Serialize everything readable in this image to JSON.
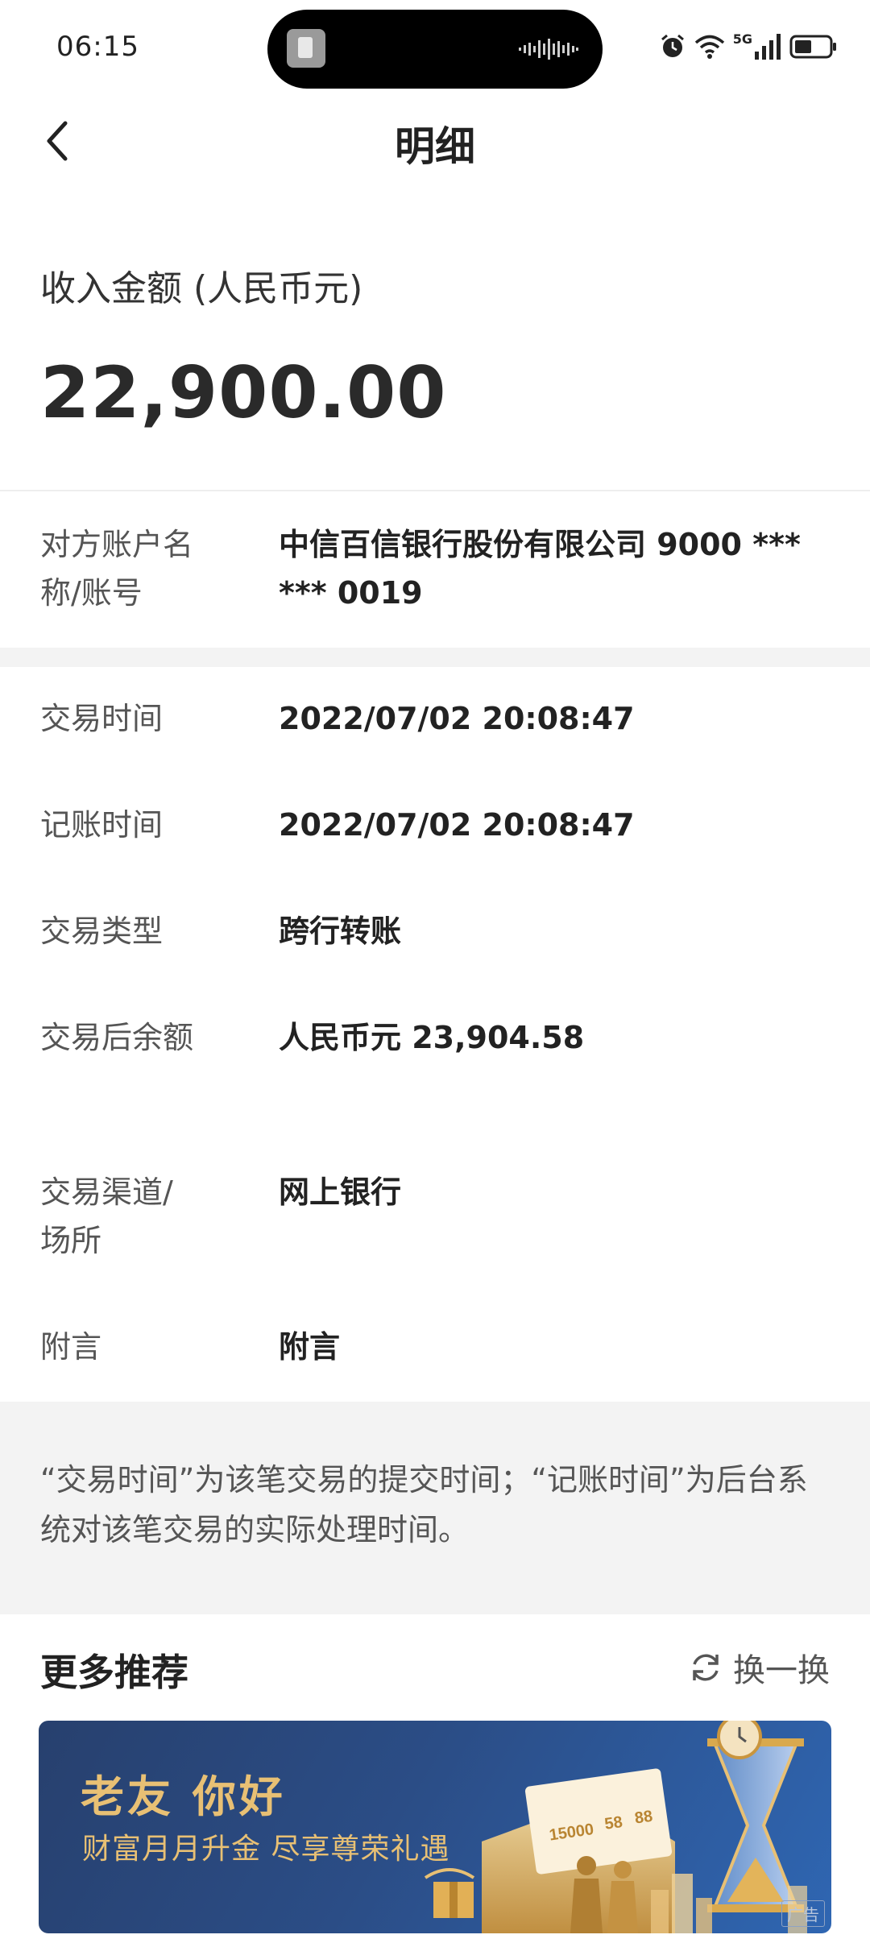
{
  "status_bar": {
    "time": "06:15",
    "network": "5G",
    "icons": [
      "alarm-icon",
      "wifi-icon",
      "signal-icon",
      "battery-icon"
    ]
  },
  "nav": {
    "title": "明细",
    "back_icon": "chevron-left-icon"
  },
  "amount": {
    "label": "收入金额 (人民币元)",
    "value": "22,900.00"
  },
  "counterparty": {
    "label": "对方账户名称/账号",
    "value": "中信百信银行股份有限公司 9000 ****** 0019"
  },
  "details": [
    {
      "label": "交易时间",
      "value": "2022/07/02 20:08:47"
    },
    {
      "label": "记账时间",
      "value": "2022/07/02 20:08:47"
    },
    {
      "label": "交易类型",
      "value": "跨行转账"
    },
    {
      "label": "交易后余额",
      "value": "人民币元 23,904.58"
    },
    {
      "label": "交易渠道/场所",
      "value": "网上银行"
    },
    {
      "label": "附言",
      "value": "附言"
    }
  ],
  "note": "“交易时间”为该笔交易的提交时间；“记账时间”为后台系统对该笔交易的实际处理时间。",
  "recommend": {
    "title": "更多推荐",
    "refresh_label": "换一换",
    "refresh_icon": "refresh-icon"
  },
  "banner": {
    "title": "老友 你好",
    "subtitle": "财富月月升金 尽享尊荣礼遇",
    "card_numbers": [
      "15000",
      "58",
      "88"
    ],
    "ad_label": "广告"
  },
  "colors": {
    "banner_gold": "#e8c074",
    "banner_blue": "#2b4d86",
    "band_gray": "#f3f3f3"
  }
}
